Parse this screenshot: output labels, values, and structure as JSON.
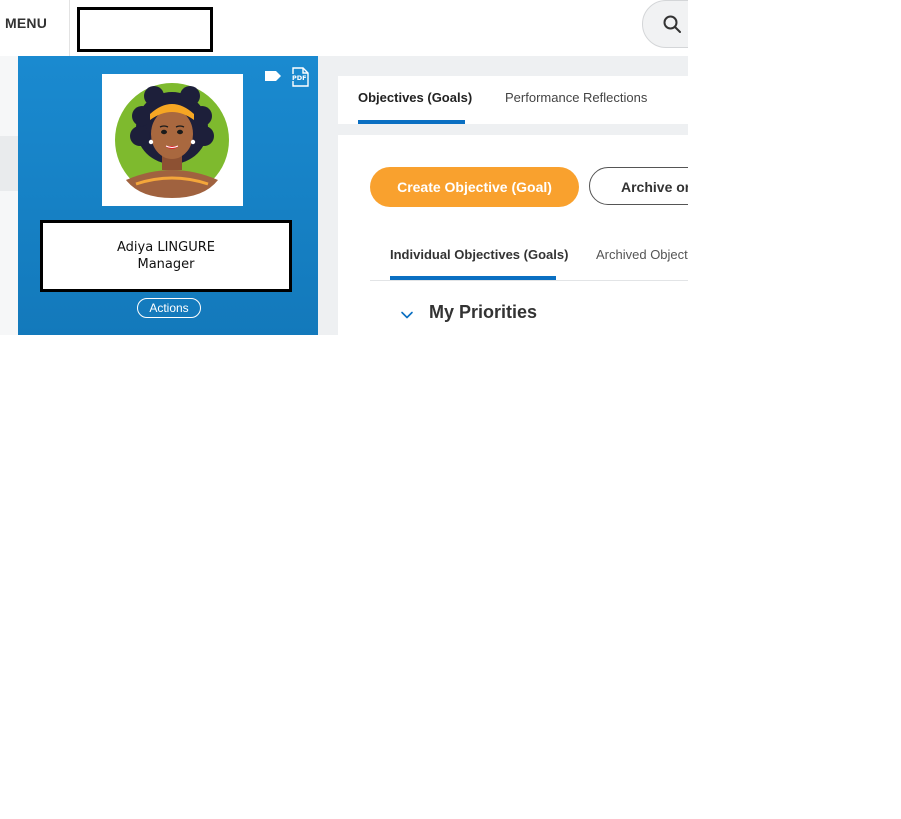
{
  "header": {
    "menu_label": "MENU",
    "search_icon": "search-icon"
  },
  "profile": {
    "name": "Adiya LINGURE",
    "role": "Manager",
    "actions_label": "Actions",
    "icons": [
      "tag-icon",
      "pdf-icon"
    ],
    "background_color": "#1a8ad0"
  },
  "main": {
    "tabs": [
      {
        "label": "Objectives (Goals)",
        "active": true
      },
      {
        "label": "Performance Reflections",
        "active": false
      }
    ],
    "buttons": {
      "create_label": "Create Objective (Goal)",
      "archive_label": "Archive or"
    },
    "subtabs": [
      {
        "label": "Individual Objectives (Goals)",
        "active": true
      },
      {
        "label": "Archived Object",
        "active": false
      }
    ],
    "section_title": "My Priorities",
    "accent_color": "#0a6fc2",
    "primary_button_color": "#f9a12e"
  }
}
